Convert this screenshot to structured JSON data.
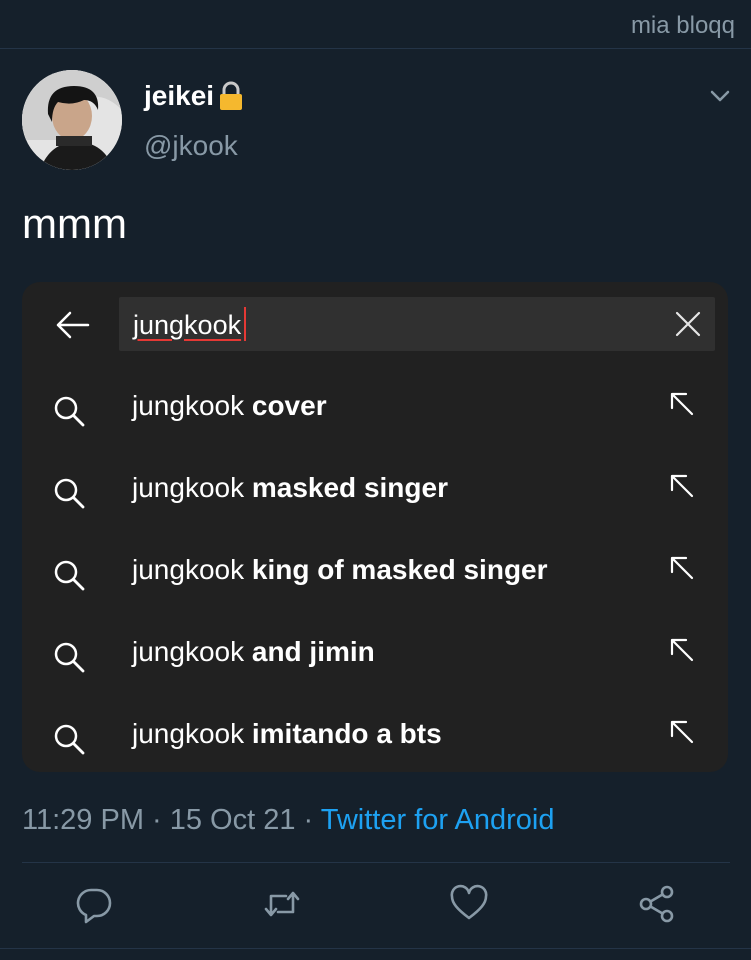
{
  "watermark": "mia bloqq",
  "user": {
    "display_name": "jeikei",
    "handle": "@jkook",
    "protected_icon": "lock-icon"
  },
  "tweet": {
    "text": "mmm",
    "timestamp": "11:29 PM · 15 Oct 21 · ",
    "source": "Twitter for Android"
  },
  "search": {
    "query": "jungkook",
    "suggestions": [
      {
        "prefix": "jungkook ",
        "rest": "cover"
      },
      {
        "prefix": "jungkook ",
        "rest": "masked singer"
      },
      {
        "prefix": "jungkook ",
        "rest": "king of masked singer"
      },
      {
        "prefix": "jungkook ",
        "rest": "and jimin"
      },
      {
        "prefix": "jungkook ",
        "rest": "imitando a bts"
      }
    ]
  },
  "colors": {
    "background": "#15202b",
    "panel": "#212121",
    "accent": "#1da1f2",
    "muted": "#8899a6",
    "caret": "#e53935"
  },
  "icons": [
    "arrow-left-icon",
    "close-icon",
    "search-icon",
    "arrow-up-left-icon",
    "reply-icon",
    "retweet-icon",
    "like-icon",
    "share-icon",
    "chevron-down-icon"
  ]
}
